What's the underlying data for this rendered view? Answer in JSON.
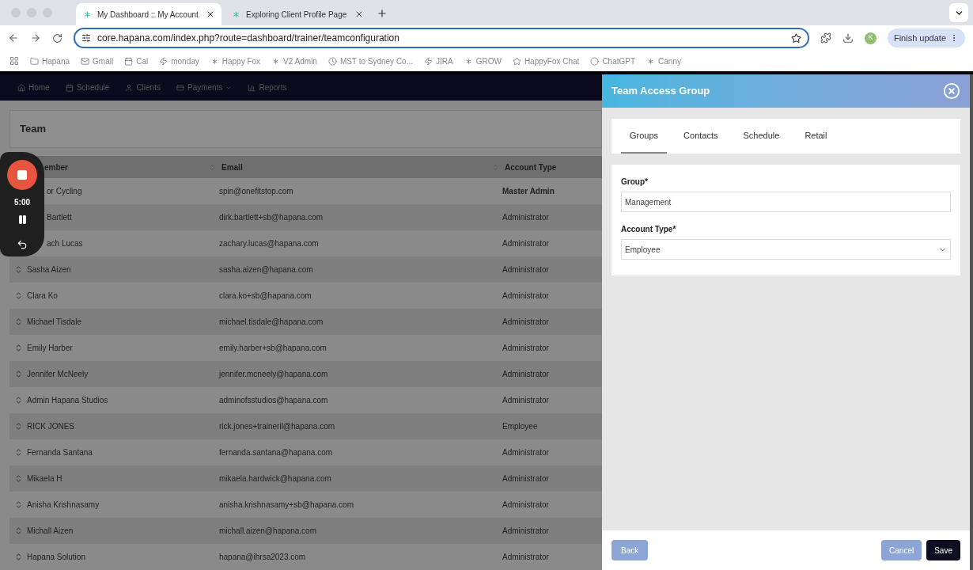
{
  "browser": {
    "tabs": [
      {
        "title": "My Dashboard :: My Account",
        "selected": true
      },
      {
        "title": "Exploring Client Profile Page",
        "selected": false
      }
    ],
    "address": "core.hapana.com/index.php?route=dashboard/trainer/teamconfiguration",
    "profile_initial": "K",
    "update_button": "Finish update",
    "bookmarks": [
      {
        "label": "Hapana",
        "kind": "folder"
      },
      {
        "label": "Gmail",
        "kind": "mail"
      },
      {
        "label": "Cal",
        "kind": "calendar"
      },
      {
        "label": "monday",
        "kind": "monday"
      },
      {
        "label": "Happy Fox",
        "kind": "star"
      },
      {
        "label": "V2 Admin",
        "kind": "star"
      },
      {
        "label": "MST to Sydney Co...",
        "kind": "clock"
      },
      {
        "label": "JIRA",
        "kind": "jira"
      },
      {
        "label": "GROW",
        "kind": "grow"
      },
      {
        "label": "HappyFox Chat",
        "kind": "fox"
      },
      {
        "label": "ChatGPT",
        "kind": "circle"
      },
      {
        "label": "Canny",
        "kind": "star"
      }
    ]
  },
  "nav": [
    {
      "label": "Home",
      "kind": "home",
      "dropdown": false
    },
    {
      "label": "Schedule",
      "kind": "calendar",
      "dropdown": false
    },
    {
      "label": "Clients",
      "kind": "user",
      "dropdown": false
    },
    {
      "label": "Payments",
      "kind": "card",
      "dropdown": true
    },
    {
      "label": "Reports",
      "kind": "chart",
      "dropdown": false
    }
  ],
  "page_title": "Team",
  "recorder": {
    "time": "5:00"
  },
  "table": {
    "columns": [
      {
        "label": "ember"
      },
      {
        "label": "Email"
      },
      {
        "label": "Account Type"
      }
    ],
    "rows": [
      {
        "name": "or Cycling",
        "email": "spin@onefitstop.com",
        "account_type": "Master Admin",
        "handle": false,
        "bold_type": true
      },
      {
        "name": "Bartlett",
        "email": "dirk.bartlett+sb@hapana.com",
        "account_type": "Administrator",
        "handle": false,
        "bold_type": false
      },
      {
        "name": "ach Lucas",
        "email": "zachary.lucas@hapana.com",
        "account_type": "Administrator",
        "handle": false,
        "bold_type": false
      },
      {
        "name": "Sasha Aizen",
        "email": "sasha.aizen@hapana.com",
        "account_type": "Administrator",
        "handle": true,
        "bold_type": false
      },
      {
        "name": "Clara Ko",
        "email": "clara.ko+sb@hapana.com",
        "account_type": "Administrator",
        "handle": true,
        "bold_type": false
      },
      {
        "name": "Michael Tisdale",
        "email": "michael.tisdale@hapana.com",
        "account_type": "Administrator",
        "handle": true,
        "bold_type": false
      },
      {
        "name": "Emily Harber",
        "email": "emily.harber+sb@hapana.com",
        "account_type": "Administrator",
        "handle": true,
        "bold_type": false
      },
      {
        "name": "Jennifer McNeely",
        "email": "jennifer.mcneely@hapana.com",
        "account_type": "Administrator",
        "handle": true,
        "bold_type": false
      },
      {
        "name": "Admin Hapana Studios",
        "email": "adminofsstudios@hapana.com",
        "account_type": "Administrator",
        "handle": true,
        "bold_type": false
      },
      {
        "name": "RICK JONES",
        "email": "rick.jones+traineril@hapana.com",
        "account_type": "Employee",
        "handle": true,
        "bold_type": false
      },
      {
        "name": "Fernanda Santana",
        "email": "fernanda.santana@hapana.com",
        "account_type": "Administrator",
        "handle": true,
        "bold_type": false
      },
      {
        "name": "Mikaela H",
        "email": "mikaela.hardwick@hapana.com",
        "account_type": "Administrator",
        "handle": true,
        "bold_type": false
      },
      {
        "name": "Anisha Krishnasamy",
        "email": "anisha.krishnasamy+sb@hapana.com",
        "account_type": "Administrator",
        "handle": true,
        "bold_type": false
      },
      {
        "name": "Michall Aizen",
        "email": "michall.aizen@hapana.com",
        "account_type": "Administrator",
        "handle": true,
        "bold_type": false
      },
      {
        "name": "Hapana Solution",
        "email": "hapana@ihrsa2023.com",
        "account_type": "Administrator",
        "handle": true,
        "bold_type": false
      }
    ]
  },
  "panel": {
    "title": "Team Access Group",
    "tabs": [
      {
        "label": "Groups",
        "selected": true
      },
      {
        "label": "Contacts",
        "selected": false
      },
      {
        "label": "Schedule",
        "selected": false
      },
      {
        "label": "Retail",
        "selected": false
      }
    ],
    "fields": [
      {
        "label": "Group*",
        "value": "Management",
        "kind": "text"
      },
      {
        "label": "Account Type*",
        "value": "Employee",
        "kind": "select"
      }
    ],
    "back": "Back",
    "cancel": "Cancel",
    "save": "Save"
  }
}
